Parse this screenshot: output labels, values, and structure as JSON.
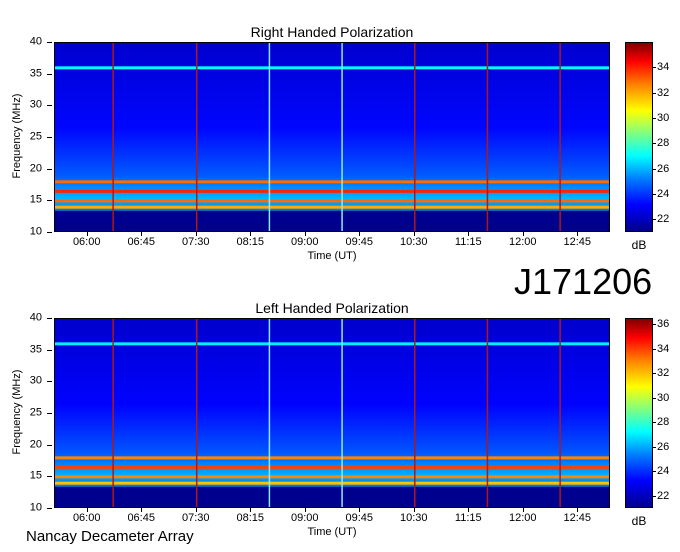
{
  "chart_data": [
    {
      "type": "heatmap",
      "title": "Right Handed Polarization",
      "xlabel": "Time (UT)",
      "ylabel": "Frequency (MHz)",
      "x_ticks": [
        "06:00",
        "06:45",
        "07:30",
        "08:15",
        "09:00",
        "09:45",
        "10:30",
        "11:15",
        "12:00",
        "12:45"
      ],
      "y_ticks": [
        10,
        15,
        20,
        25,
        30,
        35,
        40
      ],
      "ylim": [
        10,
        40
      ],
      "colorbar": {
        "label": "dB",
        "ticks": [
          22,
          24,
          26,
          28,
          30,
          32,
          34
        ],
        "range": [
          21,
          36
        ]
      },
      "bands": [
        {
          "freq_mhz": 36,
          "level_db": 27
        },
        {
          "freq_mhz": 18,
          "level_db": 33
        },
        {
          "freq_mhz": 16.5,
          "level_db": 34
        },
        {
          "freq_mhz": 15,
          "level_db": 33
        },
        {
          "freq_mhz": 14,
          "level_db": 32
        }
      ],
      "vertical_lines_utc": [
        "06:21",
        "07:30",
        "08:30",
        "09:30",
        "10:30",
        "11:30",
        "12:30"
      ]
    },
    {
      "type": "heatmap",
      "title": "Left Handed Polarization",
      "xlabel": "Time (UT)",
      "ylabel": "Frequency (MHz)",
      "x_ticks": [
        "06:00",
        "06:45",
        "07:30",
        "08:15",
        "09:00",
        "09:45",
        "10:30",
        "11:15",
        "12:00",
        "12:45"
      ],
      "y_ticks": [
        10,
        15,
        20,
        25,
        30,
        35,
        40
      ],
      "ylim": [
        10,
        40
      ],
      "colorbar": {
        "label": "dB",
        "ticks": [
          22,
          24,
          26,
          28,
          30,
          32,
          34,
          36
        ],
        "range": [
          21,
          36.5
        ]
      },
      "bands": [
        {
          "freq_mhz": 36,
          "level_db": 27
        },
        {
          "freq_mhz": 18,
          "level_db": 33
        },
        {
          "freq_mhz": 16.5,
          "level_db": 34
        },
        {
          "freq_mhz": 15,
          "level_db": 33
        },
        {
          "freq_mhz": 14,
          "level_db": 32
        }
      ],
      "vertical_lines_utc": [
        "06:21",
        "07:30",
        "08:30",
        "09:30",
        "10:30",
        "11:30",
        "12:30"
      ]
    }
  ],
  "labels": {
    "top_title": "Right Handed Polarization",
    "bottom_title": "Left Handed Polarization",
    "xlabel": "Time (UT)",
    "ylabel": "Frequency (MHz)",
    "unit": "dB",
    "code": "J171206",
    "footer": "Nancay Decameter Array"
  }
}
